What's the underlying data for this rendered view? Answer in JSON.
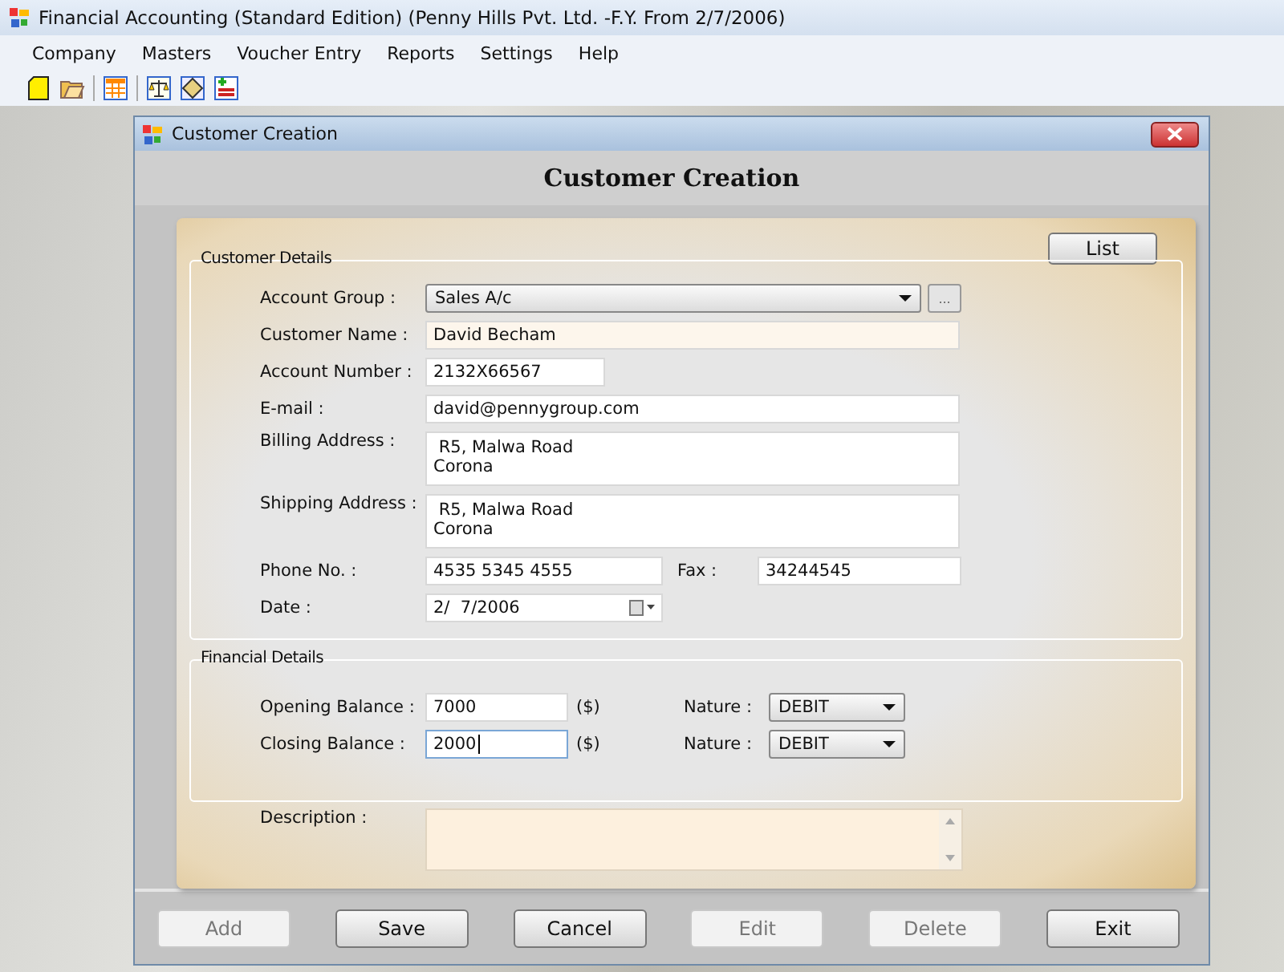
{
  "window": {
    "title": "Financial Accounting (Standard Edition) (Penny Hills Pvt. Ltd. -F.Y. From 2/7/2006)"
  },
  "menu": [
    "Company",
    "Masters",
    "Voucher Entry",
    "Reports",
    "Settings",
    "Help"
  ],
  "dialog": {
    "title": "Customer Creation",
    "heading": "Customer Creation",
    "list_button": "List"
  },
  "customer_details": {
    "legend": "Customer Details",
    "account_group": {
      "label": "Account Group :",
      "value": "Sales A/c",
      "browse": "..."
    },
    "customer_name": {
      "label": "Customer Name :",
      "value": "David Becham"
    },
    "account_number": {
      "label": "Account Number :",
      "value": "2132X66567"
    },
    "email": {
      "label": "E-mail :",
      "value": "david@pennygroup.com"
    },
    "billing_address": {
      "label": "Billing Address :",
      "lines": [
        " R5, Malwa Road",
        "Corona"
      ]
    },
    "shipping_address": {
      "label": "Shipping Address :",
      "lines": [
        " R5, Malwa Road",
        "Corona"
      ]
    },
    "phone": {
      "label": "Phone No. :",
      "value": "4535 5345 4555"
    },
    "fax": {
      "label": "Fax :",
      "value": "34244545"
    },
    "date": {
      "label": "Date :",
      "value": "2/  7/2006"
    }
  },
  "financial_details": {
    "legend": "Financial Details",
    "balances": [
      {
        "label": "Opening Balance :",
        "value": "7000",
        "unit": "($)",
        "nature_label": "Nature :",
        "nature": "DEBIT",
        "focused": false
      },
      {
        "label": "Closing Balance :",
        "value": "2000",
        "unit": "($)",
        "nature_label": "Nature :",
        "nature": "DEBIT",
        "focused": true
      }
    ]
  },
  "description": {
    "label": "Description :"
  },
  "buttons": [
    {
      "label": "Add",
      "disabled": true
    },
    {
      "label": "Save",
      "disabled": false
    },
    {
      "label": "Cancel",
      "disabled": false
    },
    {
      "label": "Edit",
      "disabled": true
    },
    {
      "label": "Delete",
      "disabled": true
    },
    {
      "label": "Exit",
      "disabled": false
    }
  ]
}
